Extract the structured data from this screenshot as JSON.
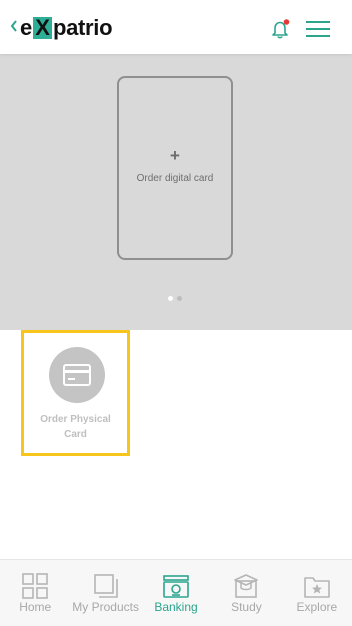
{
  "header": {
    "logo": {
      "prefix": "e",
      "boxed": "X",
      "suffix": "patrio"
    },
    "bell_badge_color": "#e53935",
    "accent_color": "#2ca58d"
  },
  "carousel": {
    "add_symbol": "+",
    "digital_card_label": "Order digital card",
    "pages": 2,
    "active_page": 1
  },
  "physical_card": {
    "label": "Order Physical Card",
    "highlight_color": "#f8c51c",
    "icon": "credit-card-icon"
  },
  "bottom_nav": {
    "items": [
      {
        "label": "Home",
        "icon": "grid-icon"
      },
      {
        "label": "My Products",
        "icon": "stacked-squares-icon"
      },
      {
        "label": "Banking",
        "icon": "bank-card-icon",
        "active": true
      },
      {
        "label": "Study",
        "icon": "graduation-cap-icon"
      },
      {
        "label": "Explore",
        "icon": "star-folder-icon"
      }
    ]
  }
}
